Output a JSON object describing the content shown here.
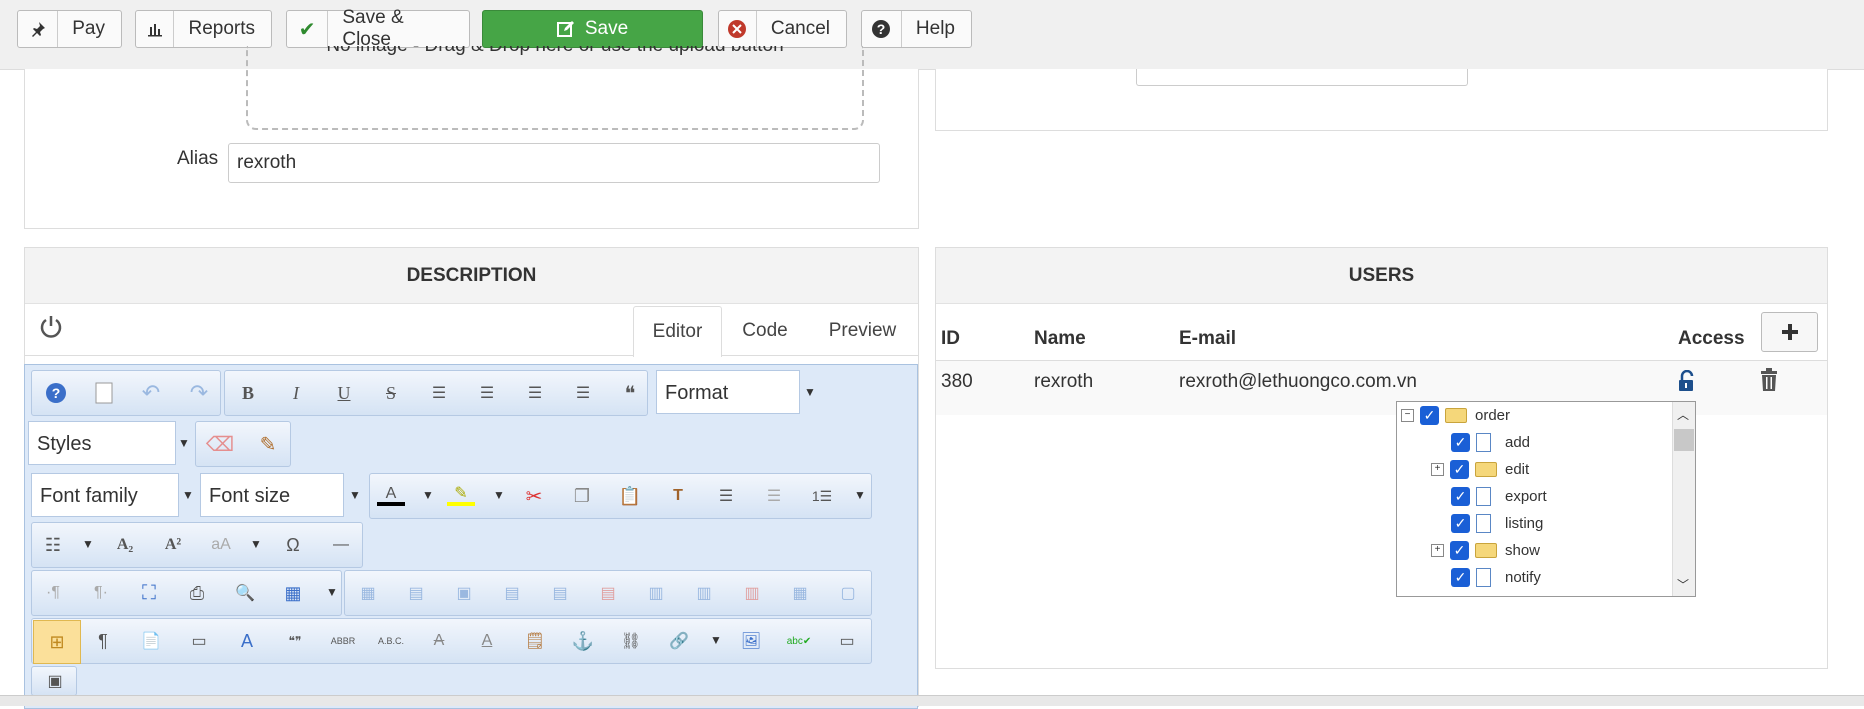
{
  "toolbar": {
    "pay_label": "Pay",
    "reports_label": "Reports",
    "save_close_label": "Save & Close",
    "save_label": "Save",
    "cancel_label": "Cancel",
    "help_label": "Help"
  },
  "details": {
    "dropzone_text": "No image - Drag & Drop here or use the upload button",
    "alias_label": "Alias",
    "alias_value": "rexroth"
  },
  "description": {
    "title": "DESCRIPTION",
    "tabs": [
      "Editor",
      "Code",
      "Preview"
    ],
    "format_label": "Format",
    "styles_label": "Styles",
    "font_family_label": "Font family",
    "font_size_label": "Font size"
  },
  "users": {
    "title": "USERS",
    "columns": [
      "ID",
      "Name",
      "E-mail",
      "Access"
    ],
    "rows": [
      {
        "id": "380",
        "name": "rexroth",
        "email": "rexroth@lethuongco.com.vn"
      }
    ]
  },
  "access_tree": {
    "nodes": [
      "order",
      "add",
      "edit",
      "export",
      "listing",
      "show",
      "notify"
    ]
  },
  "colors": {
    "save_green": "#46a546",
    "cancel_red": "#c0392b",
    "checkbox_blue": "#1a5fd6",
    "editor_bg": "#dde9f8"
  }
}
